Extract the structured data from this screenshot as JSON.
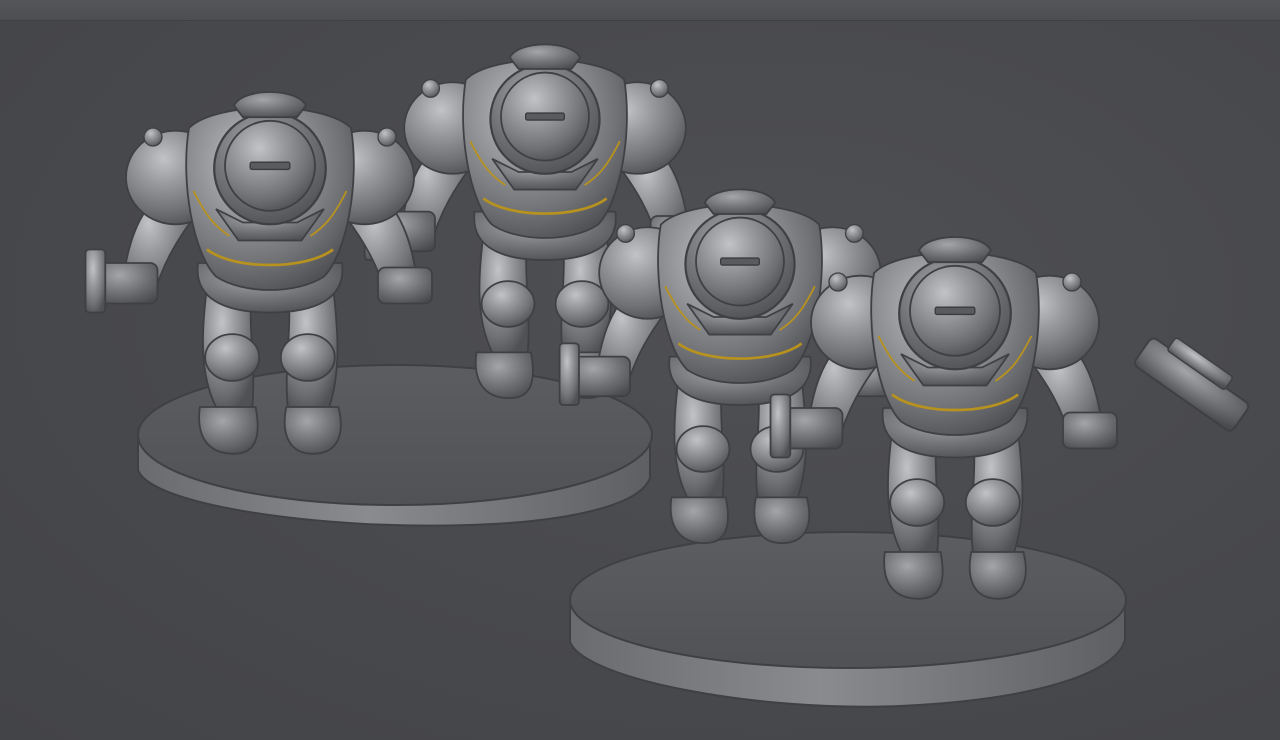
{
  "viewport": {
    "background_color": "#4a4b4f",
    "model_color": "#8d8e92",
    "accent_color": "#b8921e"
  },
  "scene": {
    "bases": 2,
    "figures": 4
  }
}
